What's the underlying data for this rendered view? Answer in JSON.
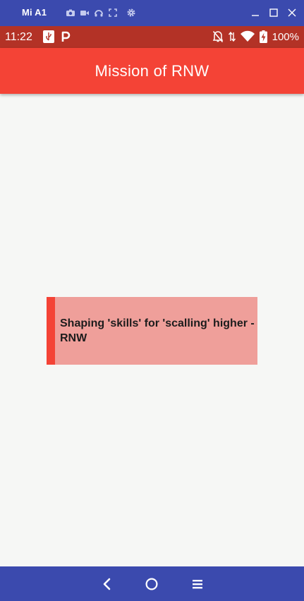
{
  "emulator": {
    "device_name": "Mi A1",
    "icons": [
      "camera-icon",
      "video-icon",
      "headphones-icon",
      "fullscreen-icon",
      "settings-icon"
    ],
    "window_controls": [
      "minimize-icon",
      "maximize-icon",
      "close-icon"
    ]
  },
  "status_bar": {
    "time": "11:22",
    "left_icons": [
      "usb-icon",
      "parking-app-icon"
    ],
    "right_icons": [
      "notifications-off-icon",
      "data-arrows-icon",
      "wifi-icon",
      "battery-charging-icon"
    ],
    "battery": "100%"
  },
  "app_bar": {
    "title": "Mission of RNW"
  },
  "mission_card": {
    "text": "Shaping 'skills' for 'scalling' higher -RNW"
  },
  "nav_bar": {
    "buttons": [
      "back-icon",
      "home-icon",
      "recents-icon"
    ]
  },
  "colors": {
    "emulator_bar": "#3b4aae",
    "status_bar": "#b33226",
    "app_bar": "#f44336",
    "card_background": "#ef9f9a",
    "card_accent": "#f44336",
    "page_background": "#f6f7f5"
  }
}
